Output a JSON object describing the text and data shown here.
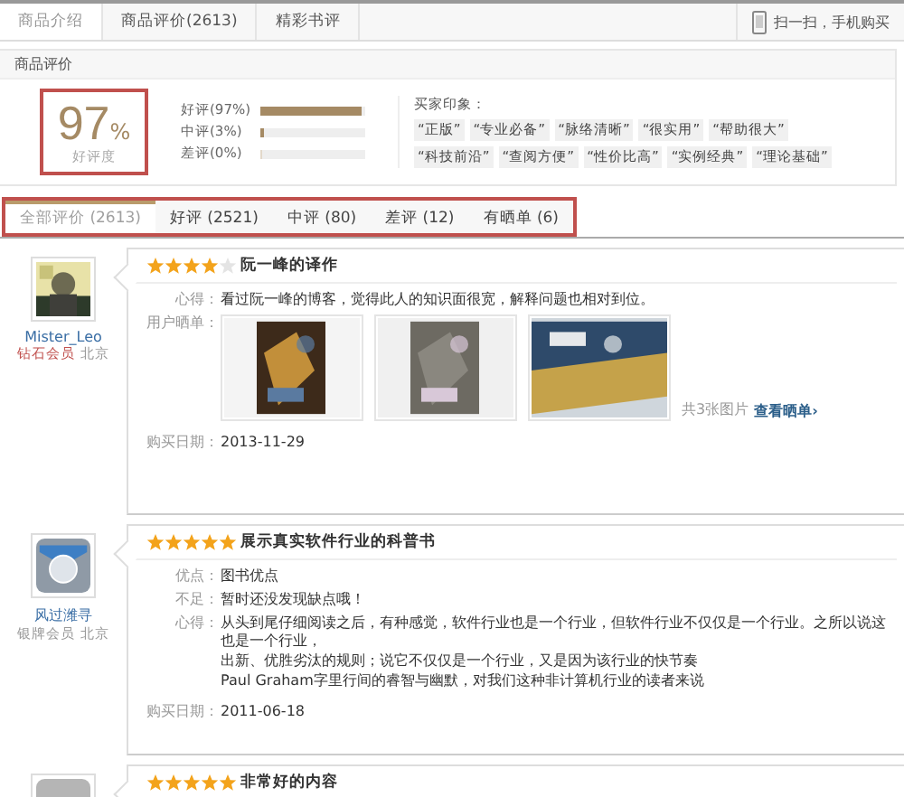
{
  "top_tabs": [
    {
      "label": "商品介绍",
      "selected": true
    },
    {
      "label": "商品评价(2613)",
      "selected": false
    },
    {
      "label": "精彩书评",
      "selected": false
    }
  ],
  "mobile_link": "扫一扫，手机购买",
  "rating": {
    "section_title": "商品评价",
    "score": "97",
    "percent": "%",
    "score_label": "好评度",
    "bars": [
      {
        "label": "好评",
        "pct": "(97%)",
        "level": 0.97
      },
      {
        "label": "中评",
        "pct": "(3%)",
        "level": 0.03
      },
      {
        "label": "差评",
        "pct": "(0%)",
        "level": 0
      }
    ],
    "impressions_label": "买家印象：",
    "tags": [
      "“正版”",
      "“专业必备”",
      "“脉络清晰”",
      "“很实用”",
      "“帮助很大”",
      "“科技前沿”",
      "“查阅方便”",
      "“性价比高”",
      "“实例经典”",
      "“理论基础”"
    ]
  },
  "filter_tabs": [
    {
      "label": "全部评价 (2613)",
      "selected": true
    },
    {
      "label": "好评 (2521)",
      "selected": false
    },
    {
      "label": "中评 (80)",
      "selected": false
    },
    {
      "label": "差评 (12)",
      "selected": false
    },
    {
      "label": "有晒单 (6)",
      "selected": false
    }
  ],
  "reviews": [
    {
      "user": "Mister_Leo",
      "rank": "钻石会员",
      "location": "北京",
      "stars": 4,
      "title": "阮一峰的译作",
      "fields": [
        {
          "label": "心得：",
          "lines": [
            "看过阮一峰的博客，觉得此人的知识面很宽，解释问题也相对到位。"
          ]
        }
      ],
      "photos_label": "用户晒单：",
      "photo_count": "共3张图片",
      "photos_link": "查看晒单›",
      "date_label": "购买日期：",
      "date": "2013-11-29"
    },
    {
      "avatar": {
        "kind": "default"
      },
      "user": "风过潍寻",
      "rank": "银牌会员",
      "location": "北京",
      "stars": 5,
      "title": "展示真实软件行业的科普书",
      "fields": [
        {
          "label": "优点：",
          "lines": [
            "图书优点"
          ]
        },
        {
          "label": "不足：",
          "lines": [
            "暂时还没发现缺点哦！"
          ]
        },
        {
          "label": "心得：",
          "lines": [
            "从头到尾仔细阅读之后，有种感觉，软件行业也是一个行业，但软件行业不仅仅是一个行业。之所以说这也是一个行业，",
            "出新、优胜劣汰的规则；说它不仅仅是一个行业，又是因为该行业的快节奏",
            "Paul Graham字里行间的睿智与幽默，对我们这种非计算机行业的读者来说"
          ]
        }
      ],
      "date_label": "购买日期：",
      "date": "2011-06-18"
    },
    {
      "avatar": {
        "kind": "blank"
      },
      "stars": 5,
      "title": "非常好的内容"
    }
  ]
}
